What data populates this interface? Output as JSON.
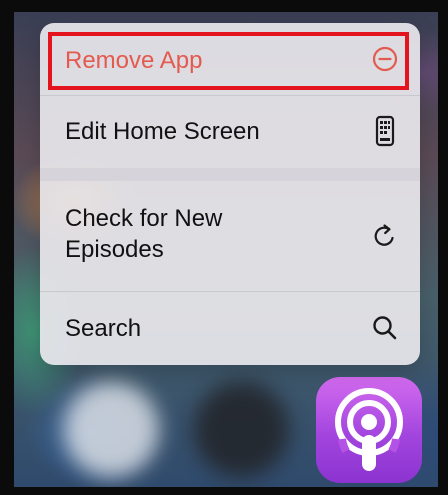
{
  "context_menu": {
    "items": [
      {
        "label": "Remove App",
        "icon": "minus-circle-icon",
        "destructive": true
      },
      {
        "label": "Edit Home Screen",
        "icon": "phone-icon"
      },
      {
        "label": "Check for New Episodes",
        "icon": "refresh-icon"
      },
      {
        "label": "Search",
        "icon": "search-icon"
      }
    ]
  },
  "app_icon": {
    "icon": "podcasts-icon"
  },
  "colors": {
    "destructive": "#e35a4e",
    "highlight": "#e3141e",
    "app_gradient_top": "#d46bf0",
    "app_gradient_bottom": "#8c33d0"
  }
}
